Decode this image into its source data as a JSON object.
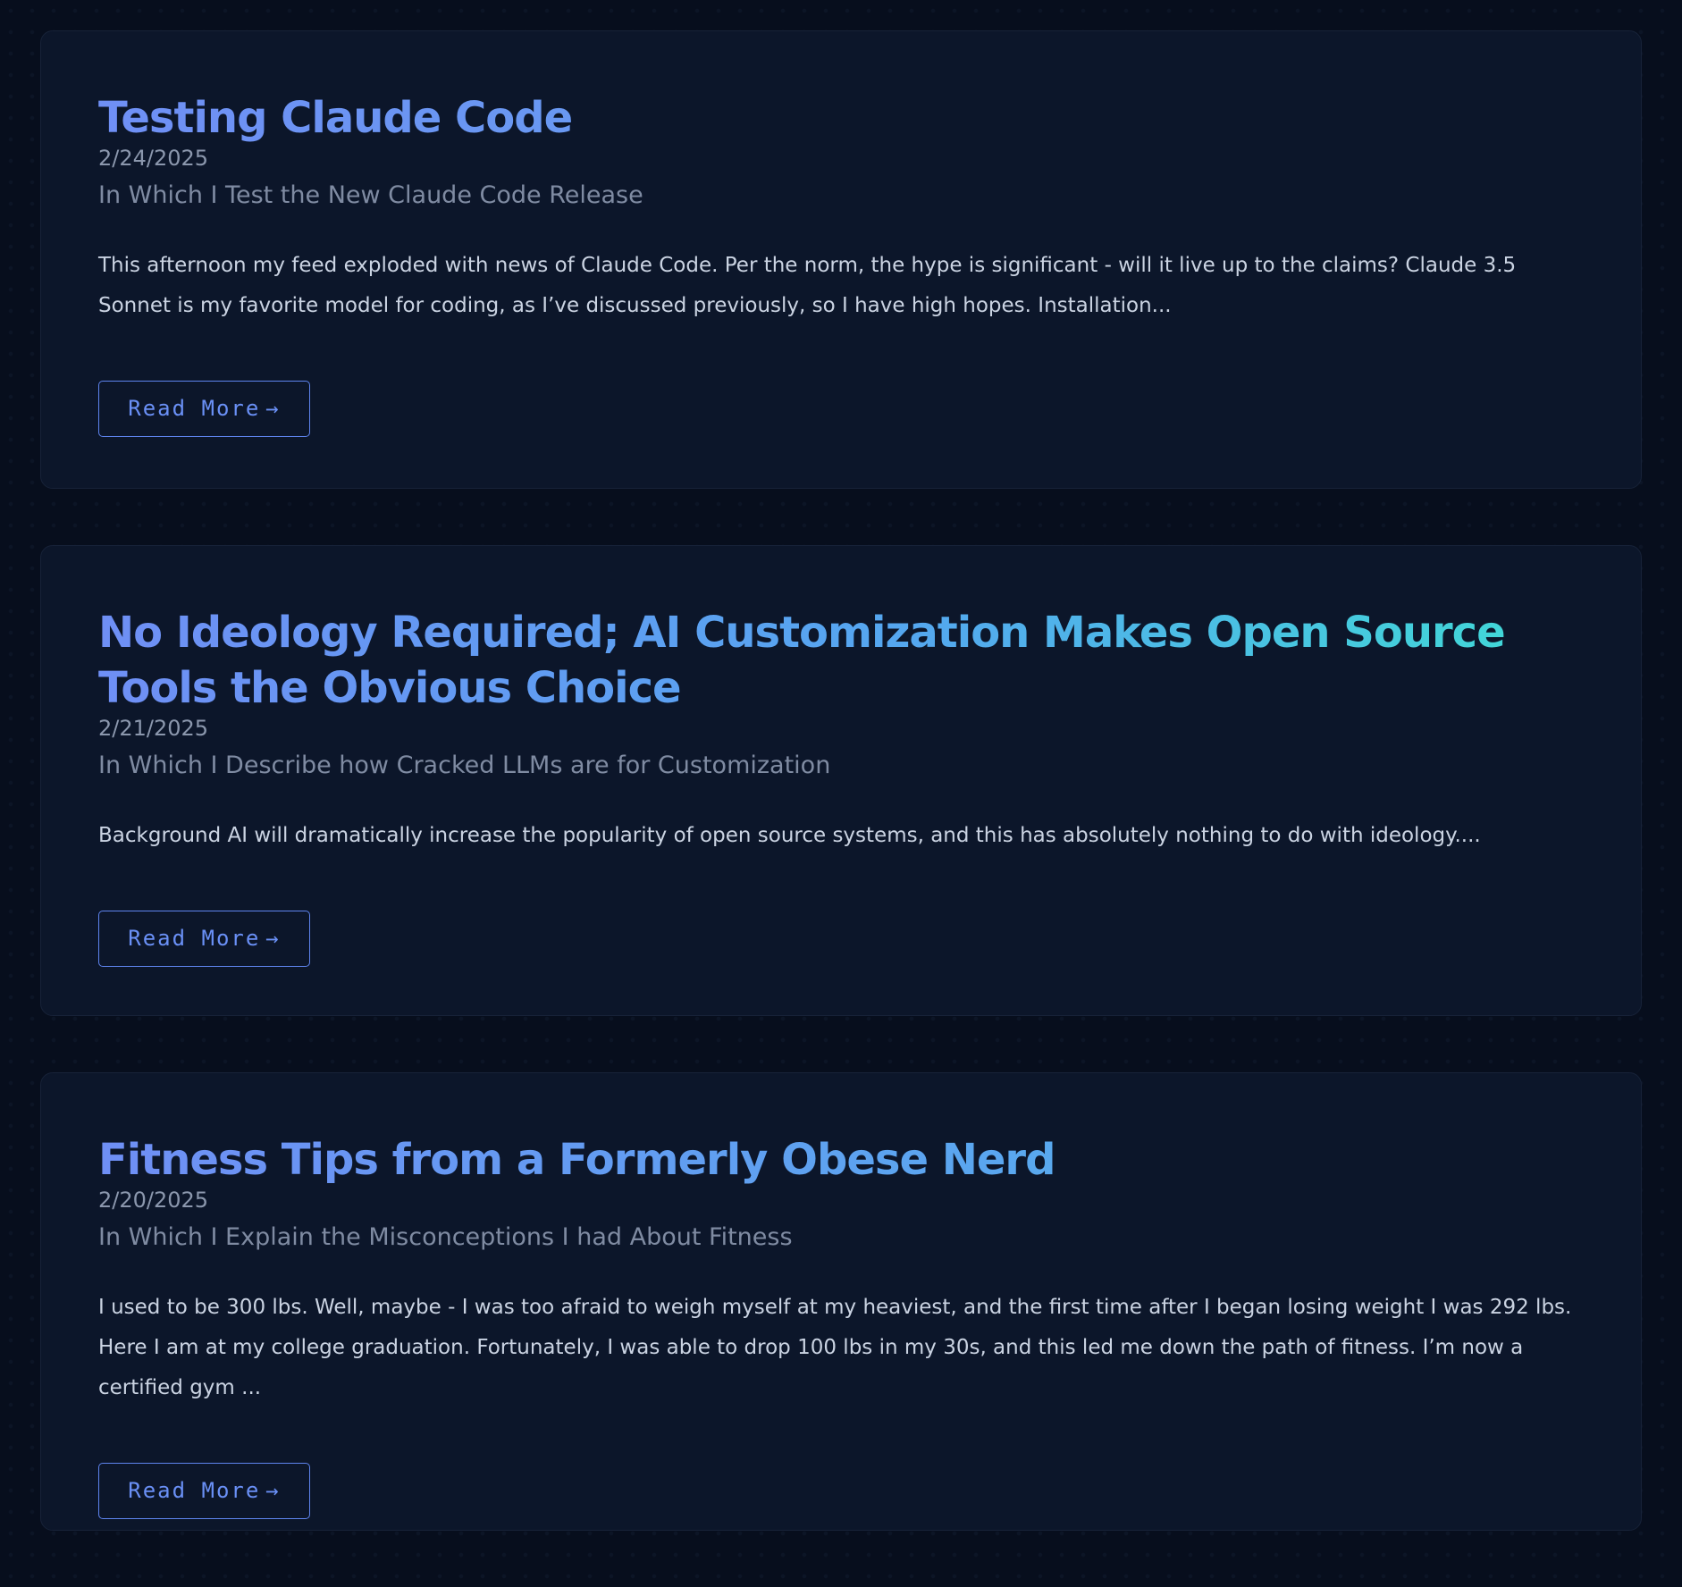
{
  "posts": [
    {
      "title": "Testing Claude Code",
      "date": "2/24/2025",
      "subtitle": "In Which I Test the New Claude Code Release",
      "excerpt": "This afternoon my feed exploded with news of Claude Code. Per the norm, the hype is significant - will it live up to the claims? Claude 3.5 Sonnet is my favorite model for coding, as I’ve discussed previously, so I have high hopes. Installation...",
      "read_more_label": "Read More",
      "read_more_arrow": "→"
    },
    {
      "title": "No Ideology Required; AI Customization Makes Open Source Tools the Obvious Choice",
      "date": "2/21/2025",
      "subtitle": "In Which I Describe how Cracked LLMs are for Customization",
      "excerpt": "Background AI will dramatically increase the popularity of open source systems, and this has absolutely nothing to do with ideology....",
      "read_more_label": "Read More",
      "read_more_arrow": "→"
    },
    {
      "title": "Fitness Tips from a Formerly Obese Nerd",
      "date": "2/20/2025",
      "subtitle": "In Which I Explain the Misconceptions I had About Fitness",
      "excerpt": "I used to be 300 lbs. Well, maybe - I was too afraid to weigh myself at my heaviest, and the first time after I began losing weight I was 292 lbs. Here I am at my college graduation. Fortunately, I was able to drop 100 lbs in my 30s, and this led me down the path of fitness. I’m now a certified gym ...",
      "read_more_label": "Read More",
      "read_more_arrow": "→"
    }
  ],
  "colors": {
    "background": "#070e1d",
    "card_background": "#0c162a",
    "title_gradient_start": "#6f8ff5",
    "title_gradient_end": "#3fdcd5",
    "button_accent": "#6a90f6",
    "date_text": "#8b97ad",
    "body_text": "#cad3e2"
  }
}
